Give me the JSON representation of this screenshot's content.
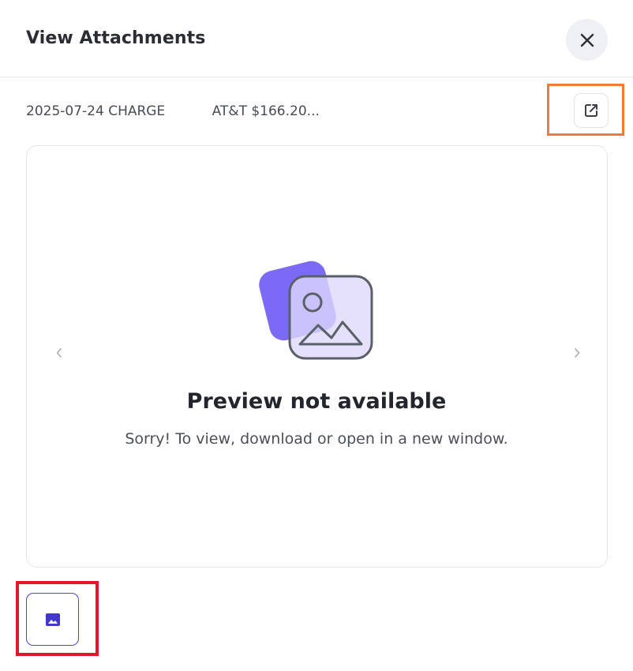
{
  "dialog": {
    "title": "View Attachments"
  },
  "attachment": {
    "name": "2025-07-24 CHARGE",
    "description": "AT&T $166.20..."
  },
  "preview": {
    "title": "Preview not available",
    "message": "Sorry! To view, download or open in a new window."
  },
  "icons": {
    "close": "close-icon",
    "open_external": "external-link-icon",
    "prev": "chevron-left-icon",
    "next": "chevron-right-icon",
    "illustration": "image-placeholder-icon",
    "thumbnail": "image-icon"
  },
  "colors": {
    "highlight_open": "#f47b35",
    "highlight_thumb": "#e3162b",
    "accent": "#4f43e6",
    "illustration_purple": "#7a6af5"
  }
}
